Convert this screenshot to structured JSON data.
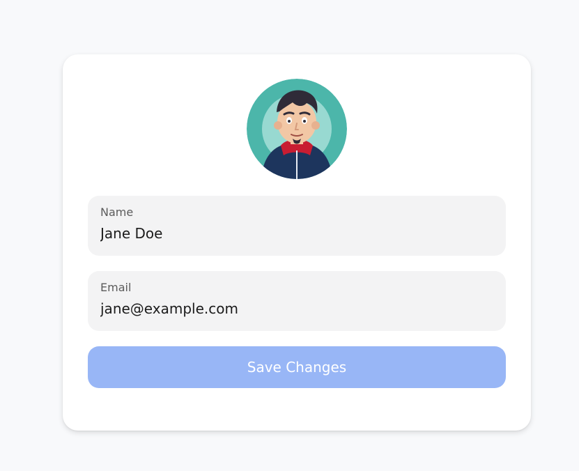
{
  "profile": {
    "avatar_icon": "profile-avatar-illustration",
    "fields": {
      "name": {
        "label": "Name",
        "value": "Jane Doe"
      },
      "email": {
        "label": "Email",
        "value": "jane@example.com"
      }
    },
    "save_label": "Save Changes"
  },
  "colors": {
    "page_background": "#f8f9fb",
    "card_background": "#ffffff",
    "field_background": "#f3f3f4",
    "button_background": "#98b6f6",
    "button_text": "#ffffff",
    "avatar_ring": "#4cb6aa"
  }
}
